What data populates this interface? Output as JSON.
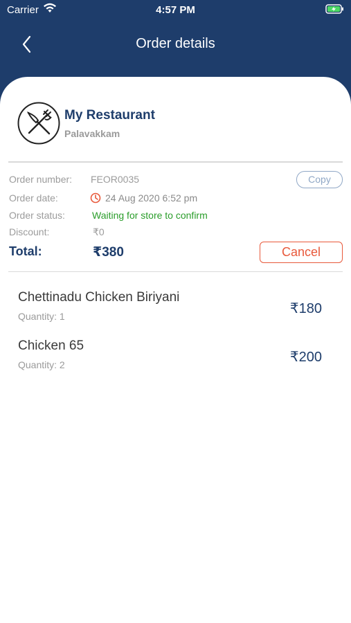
{
  "status_bar": {
    "carrier": "Carrier",
    "time": "4:57 PM"
  },
  "nav": {
    "title": "Order details",
    "back_icon": "chevron-left-icon"
  },
  "restaurant": {
    "name": "My Restaurant",
    "area": "Palavakkam",
    "logo_icon": "fork-knife-icon"
  },
  "order": {
    "number_label": "Order number:",
    "number": "FEOR0035",
    "copy_label": "Copy",
    "date_label": "Order date:",
    "date": "24 Aug 2020 6:52 pm",
    "status_label": "Order status:",
    "status": "Waiting for store to confirm",
    "discount_label": "Discount:",
    "discount": "₹0",
    "total_label": "Total:",
    "total": "₹380",
    "cancel_label": "Cancel"
  },
  "items": [
    {
      "name": "Chettinadu Chicken Biriyani",
      "quantity": "Quantity: 1",
      "price": "₹180"
    },
    {
      "name": "Chicken 65",
      "quantity": "Quantity: 2",
      "price": "₹200"
    }
  ],
  "colors": {
    "header_bg": "#1e3d6b",
    "accent_text": "#1e3d6b",
    "status_green": "#2a9d2a",
    "cancel_red": "#e8583a",
    "clock_red": "#e8583a"
  }
}
